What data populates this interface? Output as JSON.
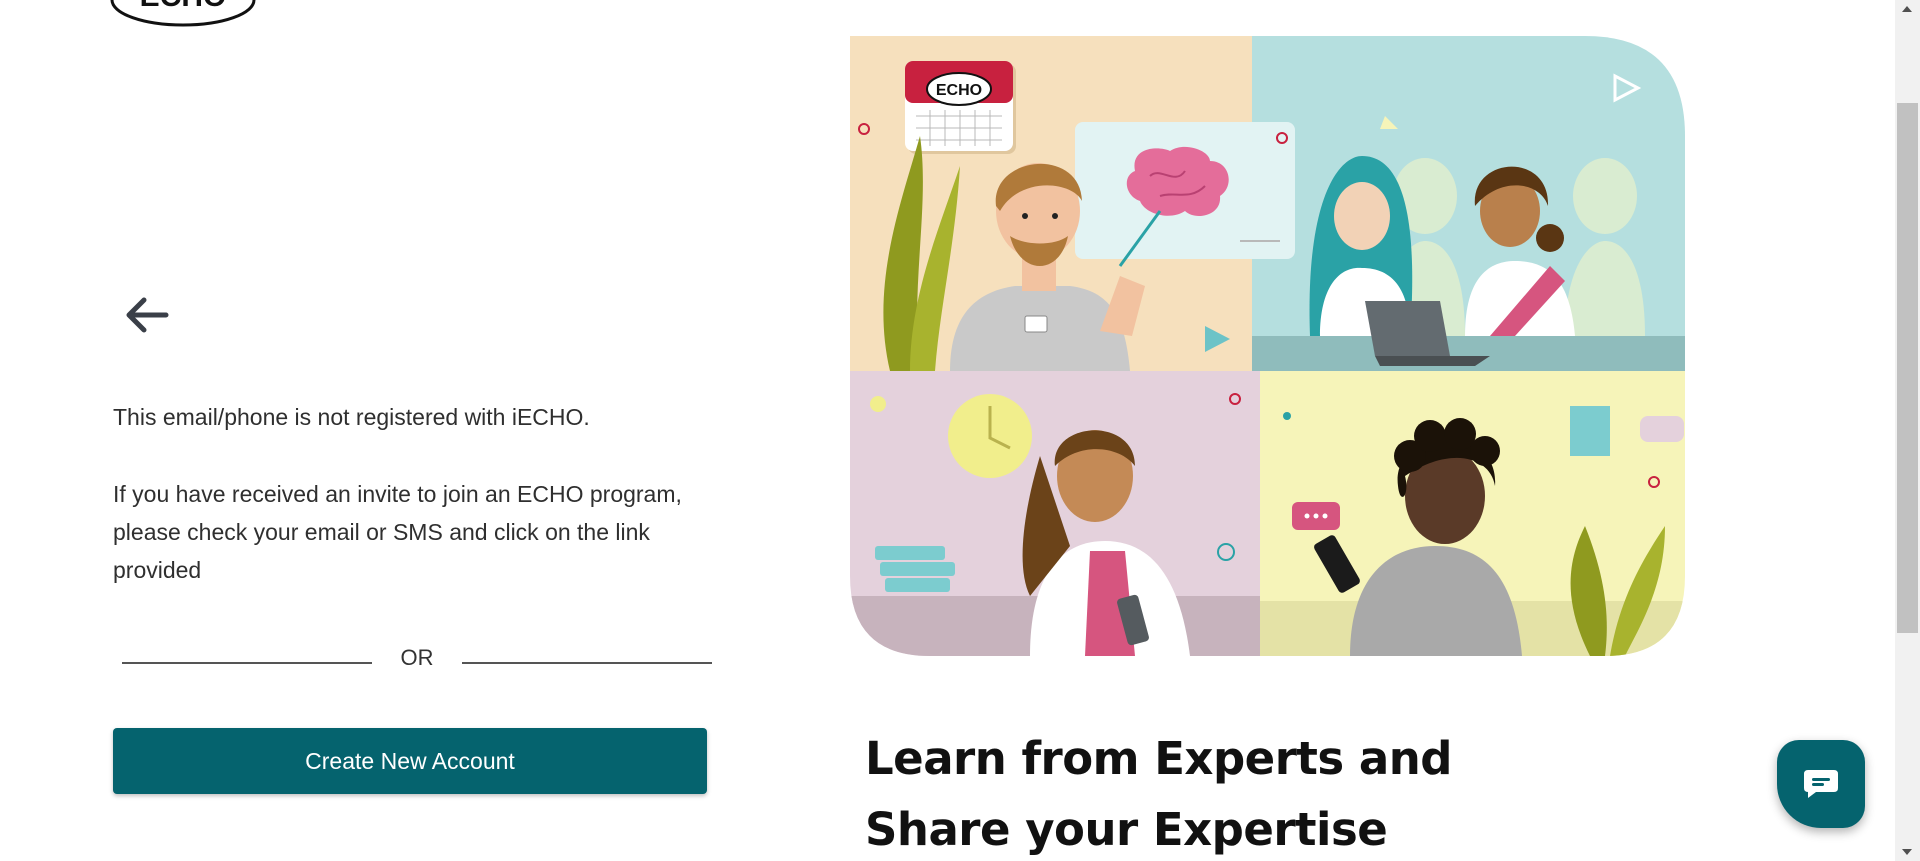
{
  "logo": {
    "text": "ECHO"
  },
  "back": {
    "icon": "arrow-left-icon"
  },
  "message": {
    "line1": "This email/phone is not registered with iECHO.",
    "line2": "If you have received an invite to join an ECHO program, please check your email or SMS and click on the link provided"
  },
  "divider": {
    "text": "OR"
  },
  "create_button": {
    "label": "Create New Account"
  },
  "hero": {
    "calendar_logo": "ECHO",
    "heading_line1": "Learn from Experts and",
    "heading_line2": "Share your Expertise"
  },
  "chat": {
    "icon": "chat-bubble-icon"
  },
  "colors": {
    "primary": "#05636e",
    "text": "#2f2f2f",
    "heading": "#111111"
  }
}
